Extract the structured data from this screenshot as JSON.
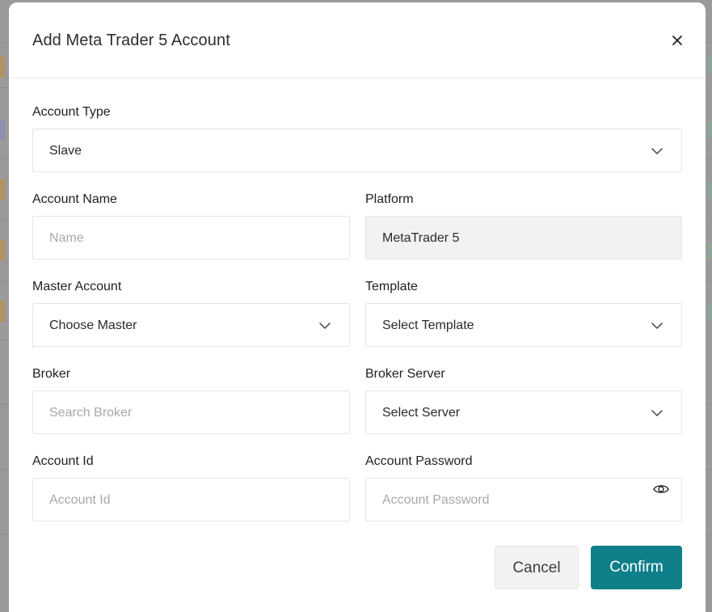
{
  "modal": {
    "title": "Add Meta Trader 5 Account",
    "close_icon": "close-icon"
  },
  "form": {
    "account_type": {
      "label": "Account Type",
      "value": "Slave",
      "icon": "chevron-down-icon"
    },
    "account_name": {
      "label": "Account Name",
      "placeholder": "Name"
    },
    "platform": {
      "label": "Platform",
      "value": "MetaTrader 5"
    },
    "master_account": {
      "label": "Master Account",
      "value": "Choose Master",
      "icon": "chevron-down-icon"
    },
    "template": {
      "label": "Template",
      "value": "Select Template",
      "icon": "chevron-down-icon"
    },
    "broker": {
      "label": "Broker",
      "placeholder": "Search Broker"
    },
    "broker_server": {
      "label": "Broker Server",
      "value": "Select Server",
      "icon": "chevron-down-icon"
    },
    "account_id": {
      "label": "Account Id",
      "placeholder": "Account Id"
    },
    "account_password": {
      "label": "Account Password",
      "placeholder": "Account Password",
      "icon": "eye-icon"
    }
  },
  "buttons": {
    "cancel": "Cancel",
    "confirm": "Confirm"
  },
  "colors": {
    "accent": "#0f7f8a",
    "overlay": "#9a9a9a",
    "border": "#e3e5e8",
    "disabled_bg": "#f1f2f3"
  }
}
